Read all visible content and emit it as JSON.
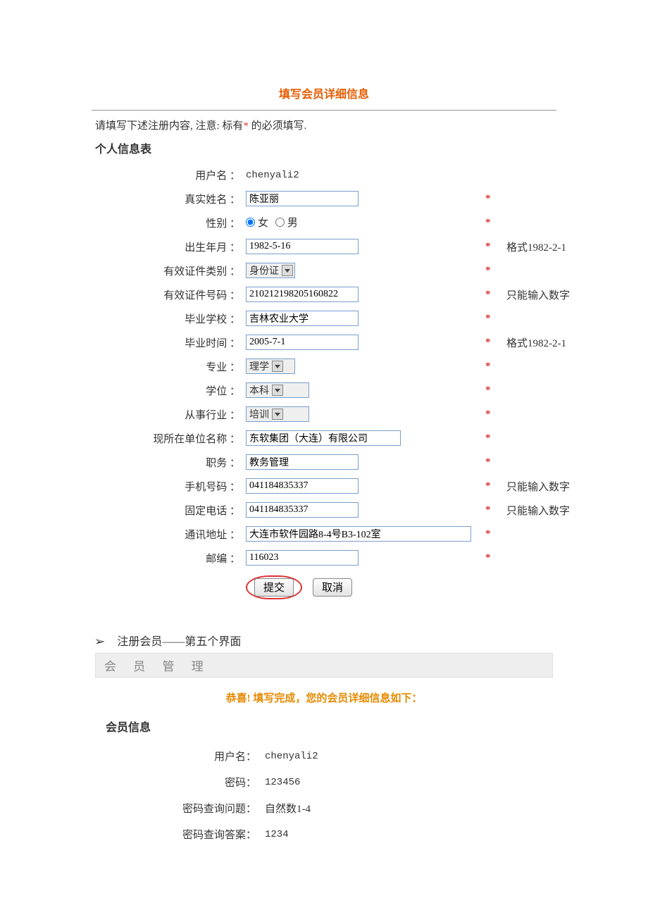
{
  "title": "填写会员详细信息",
  "instructions_prefix": "请填写下述注册内容, 注意: 标有",
  "instructions_mark": "*",
  "instructions_suffix": " 的必须填写.",
  "section_personal": "个人信息表",
  "labels": {
    "username": "用户名 ：",
    "realname": "真实姓名 ：",
    "gender": "性别 ：",
    "birthdate": "出生年月 ：",
    "idtype": "有效证件类别 ：",
    "idnumber": "有效证件号码 ：",
    "gradschool": "毕业学校 ：",
    "gradtime": "毕业时间 ：",
    "major": "专业 ：",
    "degree": "学位 ：",
    "industry": "从事行业 ：",
    "company": "现所在单位名称 ：",
    "position": "职务 ：",
    "mobile": "手机号码 ：",
    "phone": "固定电话 ：",
    "address": "通讯地址 ：",
    "postal": "邮编 ："
  },
  "values": {
    "username": "chenyali2",
    "realname": "陈亚丽",
    "birthdate": "1982-5-16",
    "idtype": "身份证",
    "idnumber": "210212198205160822",
    "gradschool": "吉林农业大学",
    "gradtime": "2005-7-1",
    "major": "理学",
    "degree": "本科",
    "industry": "培训",
    "company": "东软集团（大连）有限公司",
    "position": "教务管理",
    "mobile": "041184835337",
    "phone": "041184835337",
    "address": "大连市软件园路8-4号B3-102室",
    "postal": "116023"
  },
  "gender": {
    "female": "女",
    "male": "男"
  },
  "required": "*",
  "hints": {
    "date_format": "格式1982-2-1",
    "digits_only": "只能输入数字"
  },
  "buttons": {
    "submit": "提交",
    "cancel": "取消"
  },
  "bullet": "➢",
  "bullet_text": "注册会员——第五个界面",
  "sub_header": "会 员 管 理",
  "success_msg": "恭喜! 填写完成，您的会员详细信息如下：",
  "info_heading": "会员信息",
  "info": {
    "labels": {
      "username": "用户名：",
      "password": "密码：",
      "question": "密码查询问题：",
      "answer": "密码查询答案："
    },
    "values": {
      "username": "chenyali2",
      "password": "123456",
      "question": "自然数1-4",
      "answer": "1234"
    }
  }
}
